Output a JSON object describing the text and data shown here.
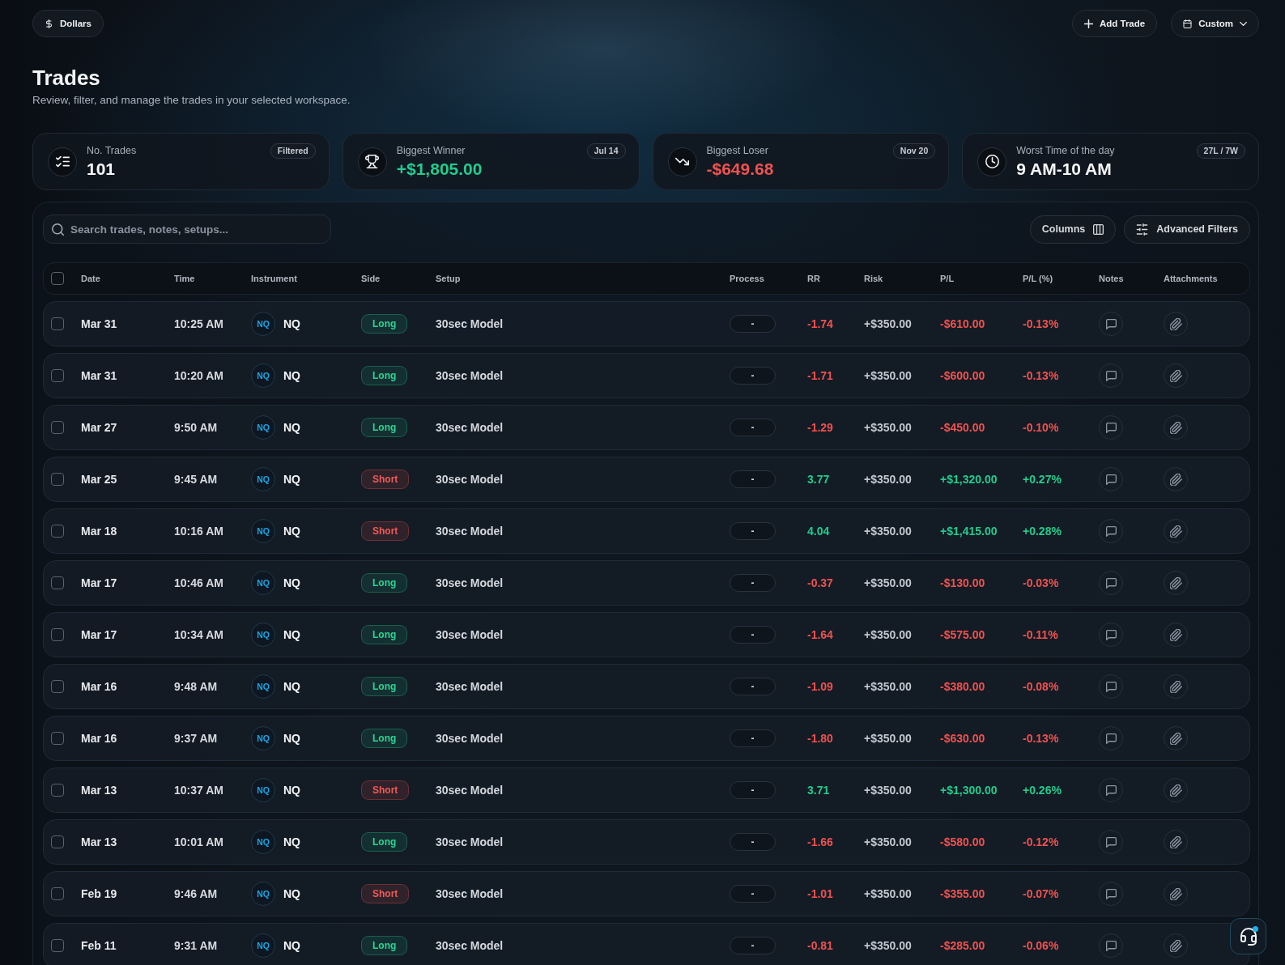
{
  "top_bar": {
    "currency_button": {
      "label": "Dollars"
    },
    "add_button": {
      "label": "Add Trade"
    },
    "range_button": {
      "label": "Custom"
    }
  },
  "page": {
    "title": "Trades",
    "subtitle": "Review, filter, and manage the trades in your selected workspace."
  },
  "stats": [
    {
      "kind": "count",
      "label": "No. Trades",
      "value": "101",
      "badge": "Filtered"
    },
    {
      "kind": "winner",
      "label": "Biggest Winner",
      "value": "+$1,805.00",
      "badge": "Jul 14"
    },
    {
      "kind": "loser",
      "label": "Biggest Loser",
      "value": "-$649.68",
      "badge": "Nov 20"
    },
    {
      "kind": "time",
      "label": "Worst Time of the day",
      "value": "9 AM-10 AM",
      "badge": "27L / 7W"
    }
  ],
  "toolbar": {
    "search": {
      "placeholder": "Search trades, notes, setups..."
    },
    "buttons": [
      {
        "kind": "columns",
        "label": "Columns"
      },
      {
        "kind": "filters",
        "label": "Advanced Filters"
      }
    ]
  },
  "table": {
    "select_all": {
      "checked": false
    },
    "columns": [
      "Date",
      "Time",
      "Instrument",
      "Side",
      "Setup",
      "Process",
      "RR",
      "Risk",
      "P/L",
      "P/L (%)",
      "Notes",
      "Attachments"
    ],
    "rows": [
      {
        "checked": false,
        "date": "Mar 31",
        "time": "10:25 AM",
        "instrument": {
          "badge": "NQ",
          "symbol": "NQ"
        },
        "side": {
          "kind": "long",
          "label": "Long"
        },
        "setup": "30sec Model",
        "process": "-",
        "rr": "-1.74",
        "risk": "+$350.00",
        "pl": "-$610.00",
        "pl_pct": "-0.13%",
        "win": false
      },
      {
        "checked": false,
        "date": "Mar 31",
        "time": "10:20 AM",
        "instrument": {
          "badge": "NQ",
          "symbol": "NQ"
        },
        "side": {
          "kind": "long",
          "label": "Long"
        },
        "setup": "30sec Model",
        "process": "-",
        "rr": "-1.71",
        "risk": "+$350.00",
        "pl": "-$600.00",
        "pl_pct": "-0.13%",
        "win": false
      },
      {
        "checked": false,
        "date": "Mar 27",
        "time": "9:50 AM",
        "instrument": {
          "badge": "NQ",
          "symbol": "NQ"
        },
        "side": {
          "kind": "long",
          "label": "Long"
        },
        "setup": "30sec Model",
        "process": "-",
        "rr": "-1.29",
        "risk": "+$350.00",
        "pl": "-$450.00",
        "pl_pct": "-0.10%",
        "win": false
      },
      {
        "checked": false,
        "date": "Mar 25",
        "time": "9:45 AM",
        "instrument": {
          "badge": "NQ",
          "symbol": "NQ"
        },
        "side": {
          "kind": "short",
          "label": "Short"
        },
        "setup": "30sec Model",
        "process": "-",
        "rr": "3.77",
        "risk": "+$350.00",
        "pl": "+$1,320.00",
        "pl_pct": "+0.27%",
        "win": true
      },
      {
        "checked": false,
        "date": "Mar 18",
        "time": "10:16 AM",
        "instrument": {
          "badge": "NQ",
          "symbol": "NQ"
        },
        "side": {
          "kind": "short",
          "label": "Short"
        },
        "setup": "30sec Model",
        "process": "-",
        "rr": "4.04",
        "risk": "+$350.00",
        "pl": "+$1,415.00",
        "pl_pct": "+0.28%",
        "win": true
      },
      {
        "checked": false,
        "date": "Mar 17",
        "time": "10:46 AM",
        "instrument": {
          "badge": "NQ",
          "symbol": "NQ"
        },
        "side": {
          "kind": "long",
          "label": "Long"
        },
        "setup": "30sec Model",
        "process": "-",
        "rr": "-0.37",
        "risk": "+$350.00",
        "pl": "-$130.00",
        "pl_pct": "-0.03%",
        "win": false
      },
      {
        "checked": false,
        "date": "Mar 17",
        "time": "10:34 AM",
        "instrument": {
          "badge": "NQ",
          "symbol": "NQ"
        },
        "side": {
          "kind": "long",
          "label": "Long"
        },
        "setup": "30sec Model",
        "process": "-",
        "rr": "-1.64",
        "risk": "+$350.00",
        "pl": "-$575.00",
        "pl_pct": "-0.11%",
        "win": false
      },
      {
        "checked": false,
        "date": "Mar 16",
        "time": "9:48 AM",
        "instrument": {
          "badge": "NQ",
          "symbol": "NQ"
        },
        "side": {
          "kind": "long",
          "label": "Long"
        },
        "setup": "30sec Model",
        "process": "-",
        "rr": "-1.09",
        "risk": "+$350.00",
        "pl": "-$380.00",
        "pl_pct": "-0.08%",
        "win": false
      },
      {
        "checked": false,
        "date": "Mar 16",
        "time": "9:37 AM",
        "instrument": {
          "badge": "NQ",
          "symbol": "NQ"
        },
        "side": {
          "kind": "long",
          "label": "Long"
        },
        "setup": "30sec Model",
        "process": "-",
        "rr": "-1.80",
        "risk": "+$350.00",
        "pl": "-$630.00",
        "pl_pct": "-0.13%",
        "win": false
      },
      {
        "checked": false,
        "date": "Mar 13",
        "time": "10:37 AM",
        "instrument": {
          "badge": "NQ",
          "symbol": "NQ"
        },
        "side": {
          "kind": "short",
          "label": "Short"
        },
        "setup": "30sec Model",
        "process": "-",
        "rr": "3.71",
        "risk": "+$350.00",
        "pl": "+$1,300.00",
        "pl_pct": "+0.26%",
        "win": true
      },
      {
        "checked": false,
        "date": "Mar 13",
        "time": "10:01 AM",
        "instrument": {
          "badge": "NQ",
          "symbol": "NQ"
        },
        "side": {
          "kind": "long",
          "label": "Long"
        },
        "setup": "30sec Model",
        "process": "-",
        "rr": "-1.66",
        "risk": "+$350.00",
        "pl": "-$580.00",
        "pl_pct": "-0.12%",
        "win": false
      },
      {
        "checked": false,
        "date": "Feb 19",
        "time": "9:46 AM",
        "instrument": {
          "badge": "NQ",
          "symbol": "NQ"
        },
        "side": {
          "kind": "short",
          "label": "Short"
        },
        "setup": "30sec Model",
        "process": "-",
        "rr": "-1.01",
        "risk": "+$350.00",
        "pl": "-$355.00",
        "pl_pct": "-0.07%",
        "win": false
      },
      {
        "checked": false,
        "date": "Feb 11",
        "time": "9:31 AM",
        "instrument": {
          "badge": "NQ",
          "symbol": "NQ"
        },
        "side": {
          "kind": "long",
          "label": "Long"
        },
        "setup": "30sec Model",
        "process": "-",
        "rr": "-0.81",
        "risk": "+$350.00",
        "pl": "-$285.00",
        "pl_pct": "-0.06%",
        "win": false
      }
    ]
  },
  "support_button": {
    "unread": true
  }
}
